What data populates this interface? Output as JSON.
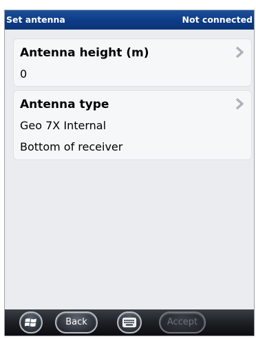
{
  "titlebar": {
    "title": "Set antenna",
    "status": "Not connected"
  },
  "antenna_height": {
    "heading": "Antenna height (m)",
    "value": "0",
    "icon": "chevron-right-icon"
  },
  "antenna_type": {
    "heading": "Antenna type",
    "value": "Geo 7X Internal",
    "measure_to": "Bottom of receiver",
    "icon": "chevron-right-icon"
  },
  "taskbar": {
    "start_icon": "windows-logo-icon",
    "back_label": "Back",
    "keyboard_icon": "keyboard-icon",
    "accept_label": "Accept",
    "accept_enabled": false
  },
  "colors": {
    "titlebar": "#0d3b85",
    "content_bg": "#ebecef",
    "card_bg": "#f6f7f9",
    "taskbar": "#1d2024"
  }
}
